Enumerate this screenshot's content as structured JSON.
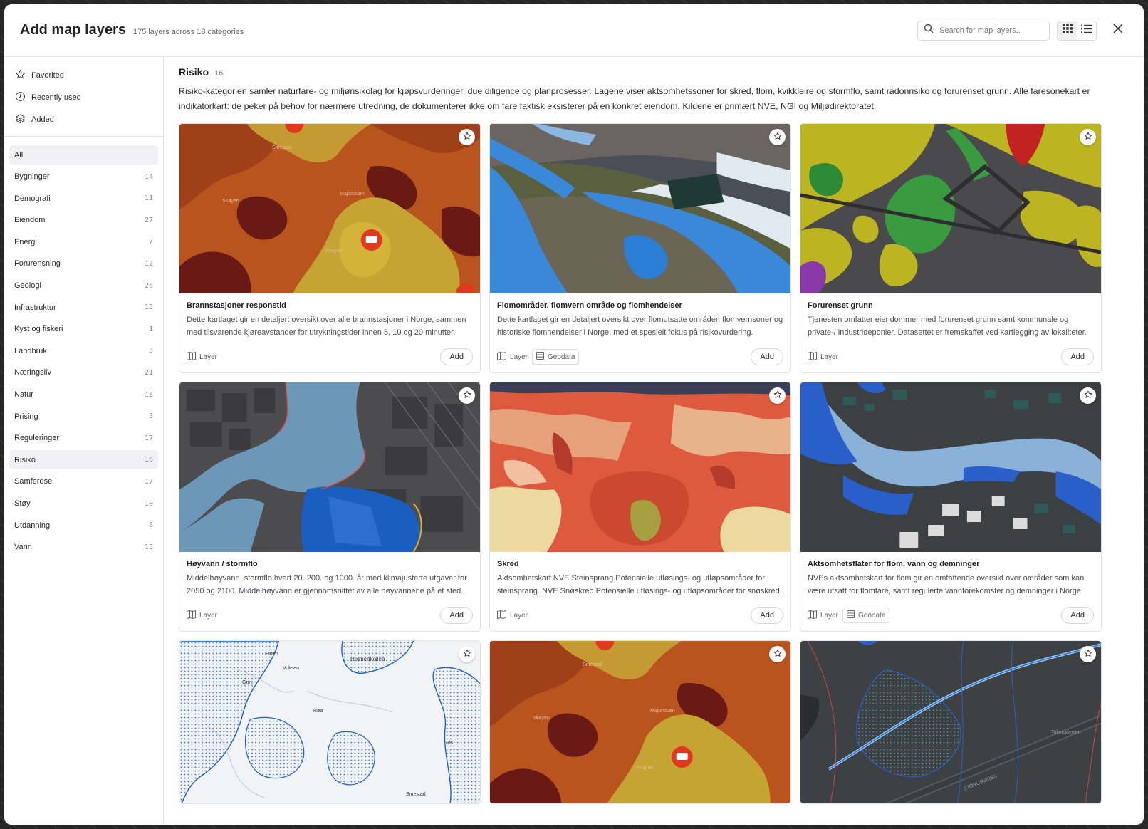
{
  "header": {
    "title": "Add map layers",
    "subtitle": "175 layers across 18 categories",
    "search_placeholder": "Search for map layers.."
  },
  "sidebar": {
    "quick": [
      {
        "label": "Favorited",
        "icon": "star-icon"
      },
      {
        "label": "Recently used",
        "icon": "clock-icon"
      },
      {
        "label": "Added",
        "icon": "layers-icon"
      }
    ],
    "categories": [
      {
        "label": "All",
        "count": ""
      },
      {
        "label": "Bygninger",
        "count": "14"
      },
      {
        "label": "Demografi",
        "count": "11"
      },
      {
        "label": "Eiendom",
        "count": "27"
      },
      {
        "label": "Energi",
        "count": "7"
      },
      {
        "label": "Forurensning",
        "count": "12"
      },
      {
        "label": "Geologi",
        "count": "26"
      },
      {
        "label": "Infrastruktur",
        "count": "15"
      },
      {
        "label": "Kyst og fiskeri",
        "count": "1"
      },
      {
        "label": "Landbruk",
        "count": "3"
      },
      {
        "label": "Næringsliv",
        "count": "21"
      },
      {
        "label": "Natur",
        "count": "13"
      },
      {
        "label": "Prising",
        "count": "3"
      },
      {
        "label": "Reguleringer",
        "count": "17"
      },
      {
        "label": "Risiko",
        "count": "16"
      },
      {
        "label": "Samferdsel",
        "count": "17"
      },
      {
        "label": "Støy",
        "count": "10"
      },
      {
        "label": "Utdanning",
        "count": "8"
      },
      {
        "label": "Vann",
        "count": "15"
      }
    ]
  },
  "main": {
    "title": "Risiko",
    "count": "16",
    "description": "Risiko-kategorien samler naturfare- og miljørisikolag for kjøpsvurderinger, due diligence og planprosesser. Lagene viser aktsomhetssoner for skred, flom, kvikkleire og stormflo, samt radonrisiko og forurenset grunn. Alle faresonekart er indikatorkart: de peker på behov for nærmere utredning, de dokumenterer ikke om fare faktisk eksisterer på en konkret eiendom. Kildene er primært NVE, NGI og Miljødirektoratet.",
    "layer_tag": "Layer",
    "geodata_tag": "Geodata",
    "add_label": "Add",
    "cards": [
      {
        "title": "Brannstasjoner responstid",
        "desc": "Dette kartlaget gir en detaljert oversikt over alle brannstasjoner i Norge, sammen med tilsvarende kjøreavstander for utrykningstider innen 5, 10 og 20 minutter."
      },
      {
        "title": "Flomområder, flomvern område og flomhendelser",
        "desc": "Dette kartlaget gir en detaljert oversikt over flomutsatte områder, flomvernsoner og historiske flomhendelser i Norge, med et spesielt fokus på risikovurdering."
      },
      {
        "title": "Forurenset grunn",
        "desc": "Tjenesten omfatter eiendommer med forurenset grunn samt kommunale og private-/ industrideponier. Datasettet er fremskaffet ved kartlegging av lokaliteter."
      },
      {
        "title": "Høyvann / stormflo",
        "desc": "Middelhøyvann, stormflo hvert 20. 200. og 1000. år med klimajusterte utgaver for 2050 og 2100. Middelhøyvann er gjennomsnittet av alle høyvannene på et sted."
      },
      {
        "title": "Skred",
        "desc": "Aktsomhetskart NVE Steinsprang Potensielle utløsings- og utløpsområder for steinsprang. NVE Snøskred Potensielle utløsings- og utløpsområder for snøskred."
      },
      {
        "title": "Aktsomhetsflater for flom, vann og demninger",
        "desc": "NVEs aktsomhetskart for flom gir en omfattende oversikt over områder som kan være utsatt for flomfare, samt regulerte vannforekomster og demninger i Norge."
      }
    ],
    "map_labels": {
      "fire": [
        "Skøyen",
        "Majorstuen",
        "Frogner",
        "Smestad"
      ],
      "blue": [
        "Holmenkollen",
        "Voksen",
        "Frøen",
        "Røa",
        "Ris",
        "Smestad",
        "Grini"
      ],
      "stream": [
        "Tokerudveien",
        "STORUSVEIEN"
      ]
    }
  }
}
